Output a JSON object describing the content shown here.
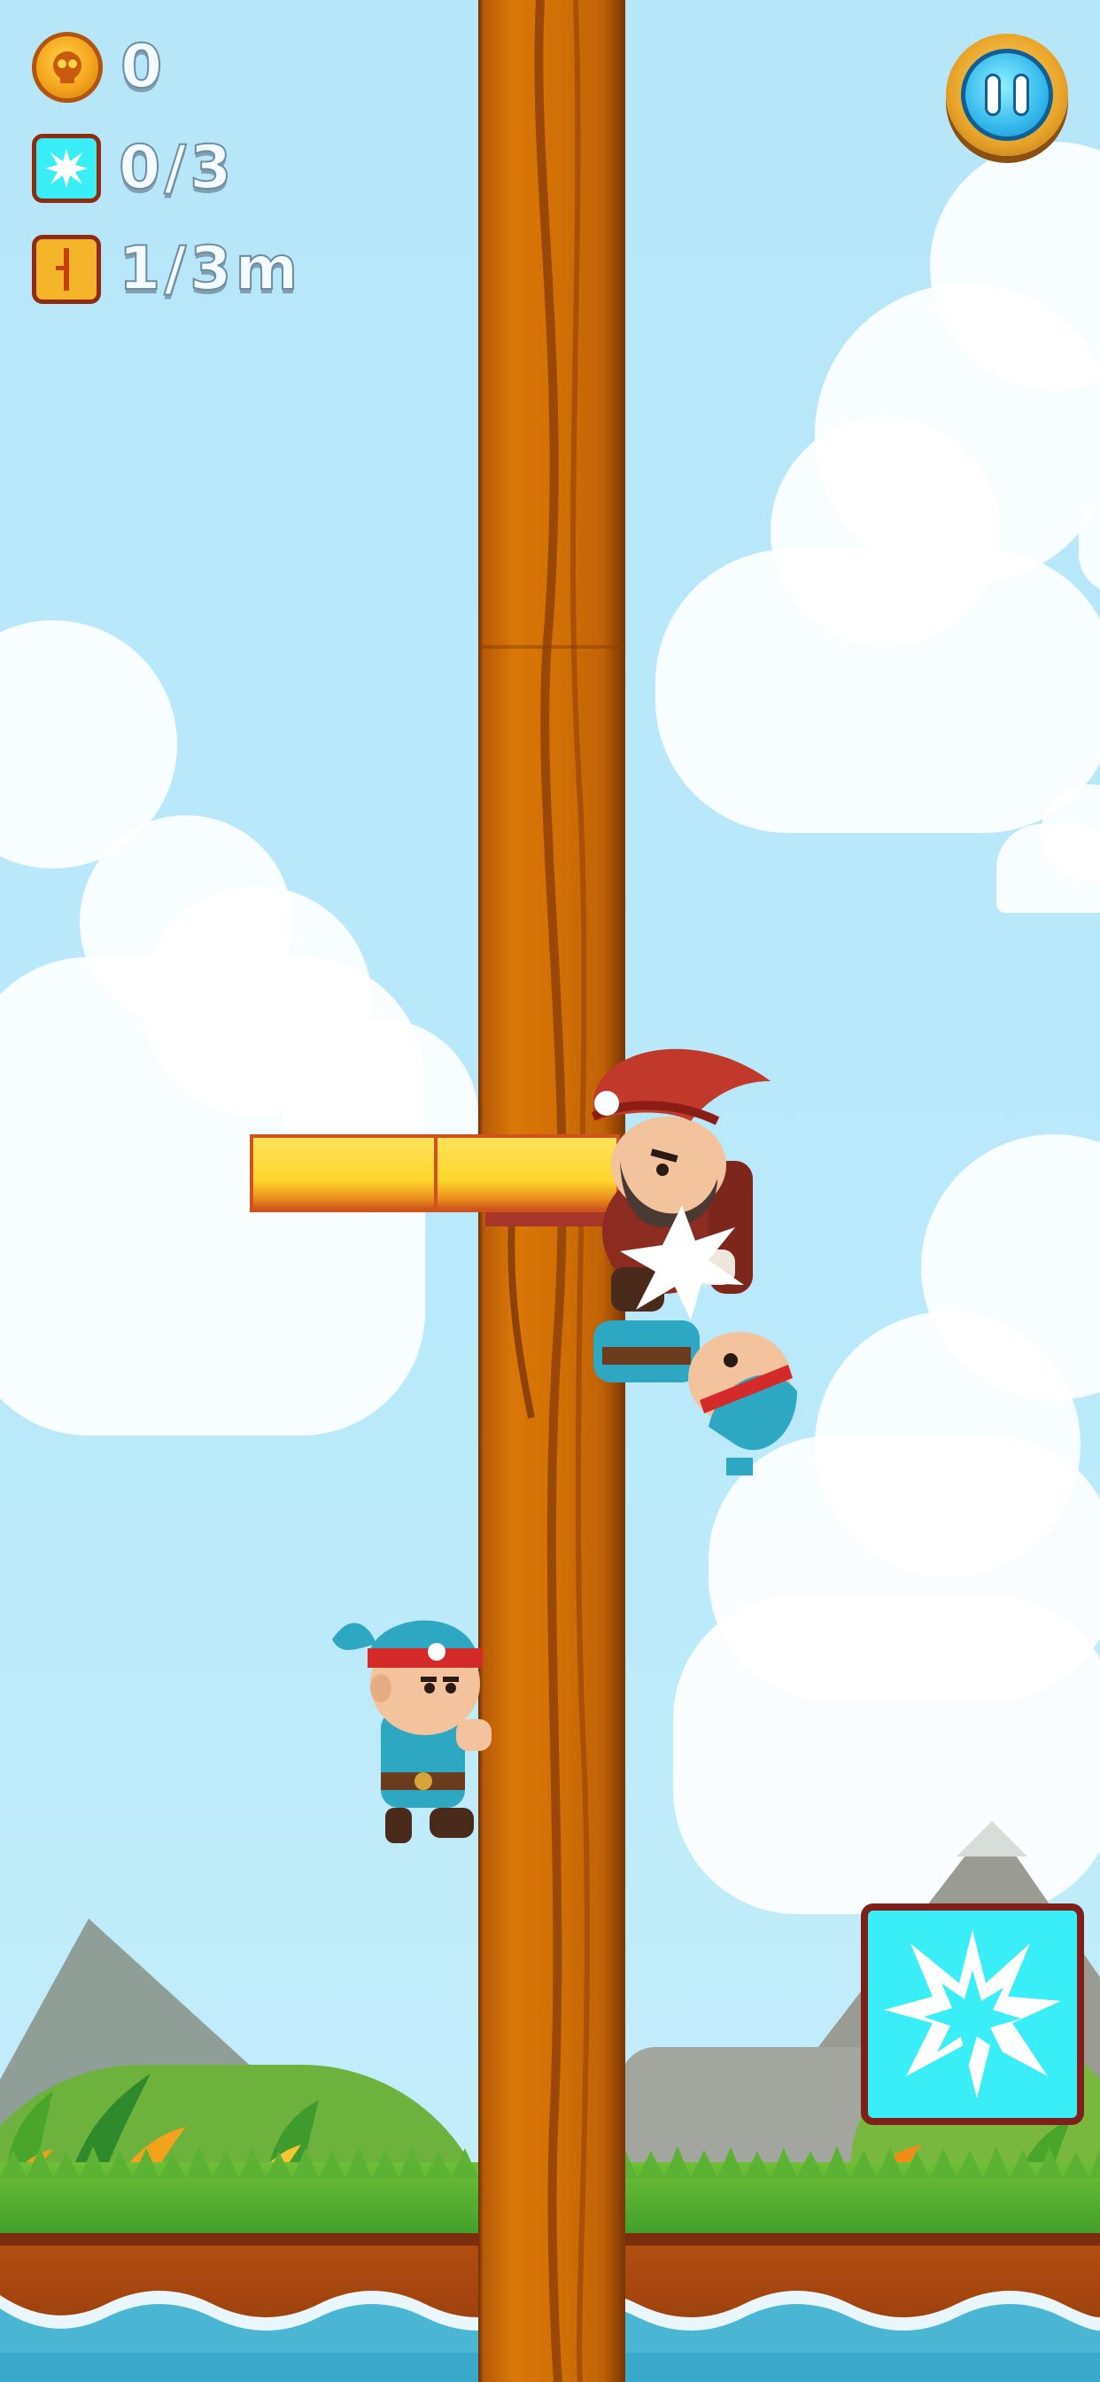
{
  "hud": {
    "coins": "0",
    "special": "0/3",
    "height": "1/3m"
  },
  "icons": {
    "coin": "skull-coin-icon",
    "special": "burst-icon",
    "height": "height-marker-icon",
    "pause": "pause-icon",
    "special_action": "burst-icon"
  },
  "colors": {
    "sky": "#b9e9fa",
    "special_cyan": "#39eef7",
    "hud_border": "#8e2c12",
    "trunk": "#d97707",
    "beam": "#ffd52b"
  }
}
